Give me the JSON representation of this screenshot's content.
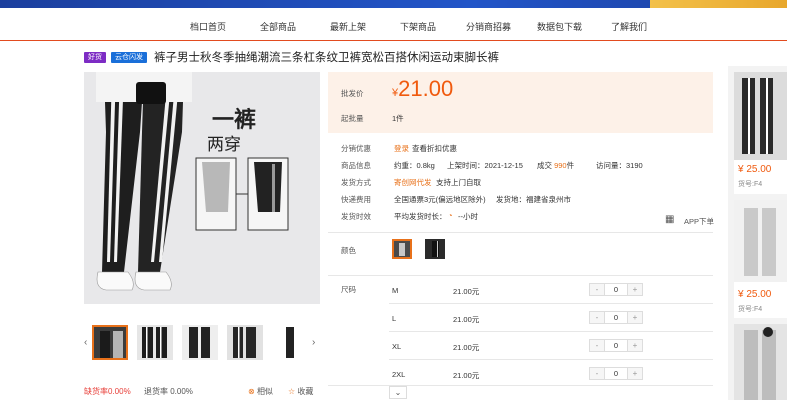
{
  "nav": [
    "档口首页",
    "全部商品",
    "最新上架",
    "下架商品",
    "分销商招募",
    "数据包下载",
    "了解我们"
  ],
  "badges": [
    "好货",
    "云仓闪发"
  ],
  "product_title": "裤子男士秋冬季抽绳潮流三条杠条纹卫裤宽松百搭休闲运动束脚长裤",
  "promo": {
    "line1": "一裤",
    "line2": "两穿"
  },
  "price": {
    "label": "批发价",
    "currency": "¥",
    "amount": "21.00",
    "min_label": "起批量",
    "min_value": "1件"
  },
  "info": {
    "discount_label": "分销优惠",
    "discount_link": "登录",
    "discount_text": "查看折扣优惠",
    "goods_label": "商品信息",
    "weight": "约重：0.8kg",
    "date": "上架时间：2021-12-15",
    "deals_prefix": "成交",
    "deals_count": "990",
    "deals_suffix": "件",
    "visits": "访问量：3190",
    "ship_method_label": "发货方式",
    "ship_method_link": "寄创网代发",
    "ship_method_text": "支持上门自取",
    "fee_label": "快递费用",
    "fee_text": "全国通票3元(偏远地区除外)",
    "origin": "发货地：福建省泉州市",
    "time_label": "发货时效",
    "time_text": "平均发货时长：",
    "time_value": "--小时"
  },
  "app_order": "APP下单",
  "color_label": "颜色",
  "size_label": "尺码",
  "sizes": [
    {
      "size": "M",
      "price": "21.00元",
      "qty": "0"
    },
    {
      "size": "L",
      "price": "21.00元",
      "qty": "0"
    },
    {
      "size": "XL",
      "price": "21.00元",
      "qty": "0"
    },
    {
      "size": "2XL",
      "price": "21.00元",
      "qty": "0"
    }
  ],
  "stepper": {
    "minus": "-",
    "plus": "+"
  },
  "bottom": {
    "defect_label": "缺货率",
    "defect_value": "0.00%",
    "return_label": "退货率",
    "return_value": "0.00%",
    "similar": "相似",
    "favorite": "收藏"
  },
  "side": [
    {
      "price": "¥ 25.00",
      "code": "货号:F4"
    },
    {
      "price": "¥ 25.00",
      "code": "货号:F4"
    }
  ],
  "colors": {
    "accent": "#f05a0e",
    "nav_border": "#e24b1f",
    "price_bg": "#fdf1e8"
  }
}
